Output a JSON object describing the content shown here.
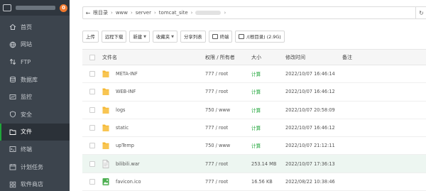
{
  "sidebar": {
    "badge": "0",
    "items": [
      {
        "label": "首页",
        "icon": "home-icon"
      },
      {
        "label": "网站",
        "icon": "globe-icon"
      },
      {
        "label": "FTP",
        "icon": "ftp-icon"
      },
      {
        "label": "数据库",
        "icon": "database-icon"
      },
      {
        "label": "监控",
        "icon": "monitor-icon"
      },
      {
        "label": "安全",
        "icon": "shield-icon"
      },
      {
        "label": "文件",
        "icon": "folder-icon",
        "active": true
      },
      {
        "label": "终端",
        "icon": "terminal-icon"
      },
      {
        "label": "计划任务",
        "icon": "calendar-icon"
      },
      {
        "label": "软件商店",
        "icon": "store-icon"
      }
    ]
  },
  "path": {
    "crumbs": [
      "根目录",
      "www",
      "server",
      "tomcat_site"
    ]
  },
  "toolbar": {
    "upload": "上传",
    "remote_download": "远程下载",
    "new": "新建",
    "favorites": "收藏夹",
    "share_list": "分享列表",
    "terminal": "终端",
    "disk": "/(根目录) (2.9G)"
  },
  "table": {
    "headers": {
      "name": "文件名",
      "perm": "权限 / 所有者",
      "size": "大小",
      "time": "修改时间",
      "note": "备注"
    },
    "rows": [
      {
        "name": "META-INF",
        "type": "folder",
        "perm": "777 / root",
        "size": "计算",
        "time": "2022/10/07 16:46:14"
      },
      {
        "name": "WEB-INF",
        "type": "folder",
        "perm": "777 / root",
        "size": "计算",
        "time": "2022/10/07 16:46:12"
      },
      {
        "name": "logs",
        "type": "folder",
        "perm": "750 / www",
        "size": "计算",
        "time": "2022/10/07 20:58:09"
      },
      {
        "name": "static",
        "type": "folder",
        "perm": "777 / root",
        "size": "计算",
        "time": "2022/10/07 16:46:12"
      },
      {
        "name": "upTemp",
        "type": "folder",
        "perm": "750 / www",
        "size": "计算",
        "time": "2022/10/07 21:12:11"
      },
      {
        "name": "bilibili.war",
        "type": "file",
        "perm": "777 / root",
        "size": "253.14 MB",
        "time": "2022/10/07 17:36:13"
      },
      {
        "name": "favicon.ico",
        "type": "image",
        "perm": "777 / root",
        "size": "16.56 KB",
        "time": "2022/08/22 10:38:46"
      }
    ]
  },
  "colors": {
    "accent": "#20a53a",
    "sidebar_bg": "#3c444d",
    "folder": "#f5b731",
    "badge": "#f0782d"
  }
}
